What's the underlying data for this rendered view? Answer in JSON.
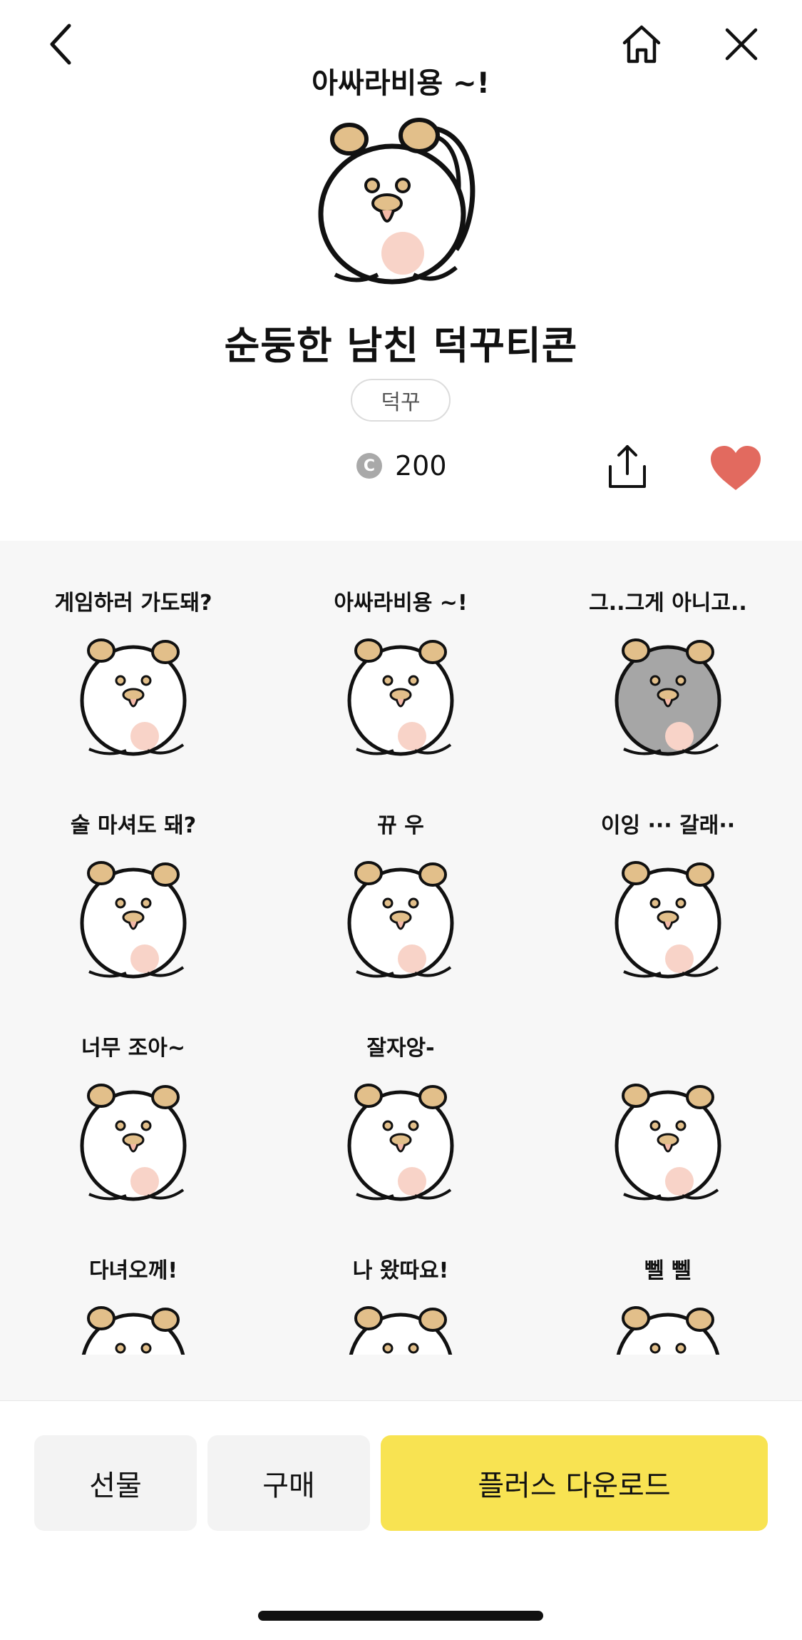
{
  "header": {
    "back_icon": "chevron-left-icon",
    "home_icon": "home-icon",
    "close_icon": "close-icon"
  },
  "hero": {
    "caption": "아싸라비용 ~!"
  },
  "item": {
    "title": "순둥한 남친 덕꾸티콘",
    "author": "덕꾸",
    "coin_symbol": "C",
    "price": "200",
    "share_icon": "share-icon",
    "like_icon": "heart-icon",
    "like_color": "#e26a5f"
  },
  "stickers": [
    {
      "caption": "게임하러 가도돼?"
    },
    {
      "caption": "아싸라비용 ~!"
    },
    {
      "caption": "그..그게 아니고.."
    },
    {
      "caption": "술 마셔도 돼?"
    },
    {
      "caption": "뀨            우"
    },
    {
      "caption": "이잉 ··· 갈래··"
    },
    {
      "caption": "너무 조아~"
    },
    {
      "caption": "잘자앙-"
    },
    {
      "caption": ""
    },
    {
      "caption": "다녀오께!"
    },
    {
      "caption": "나 왔따요!"
    },
    {
      "caption": "뻴              뻴"
    }
  ],
  "actions": {
    "gift_label": "선물",
    "buy_label": "구매",
    "plus_download_label": "플러스 다운로드",
    "accent_color": "#f8e352"
  }
}
